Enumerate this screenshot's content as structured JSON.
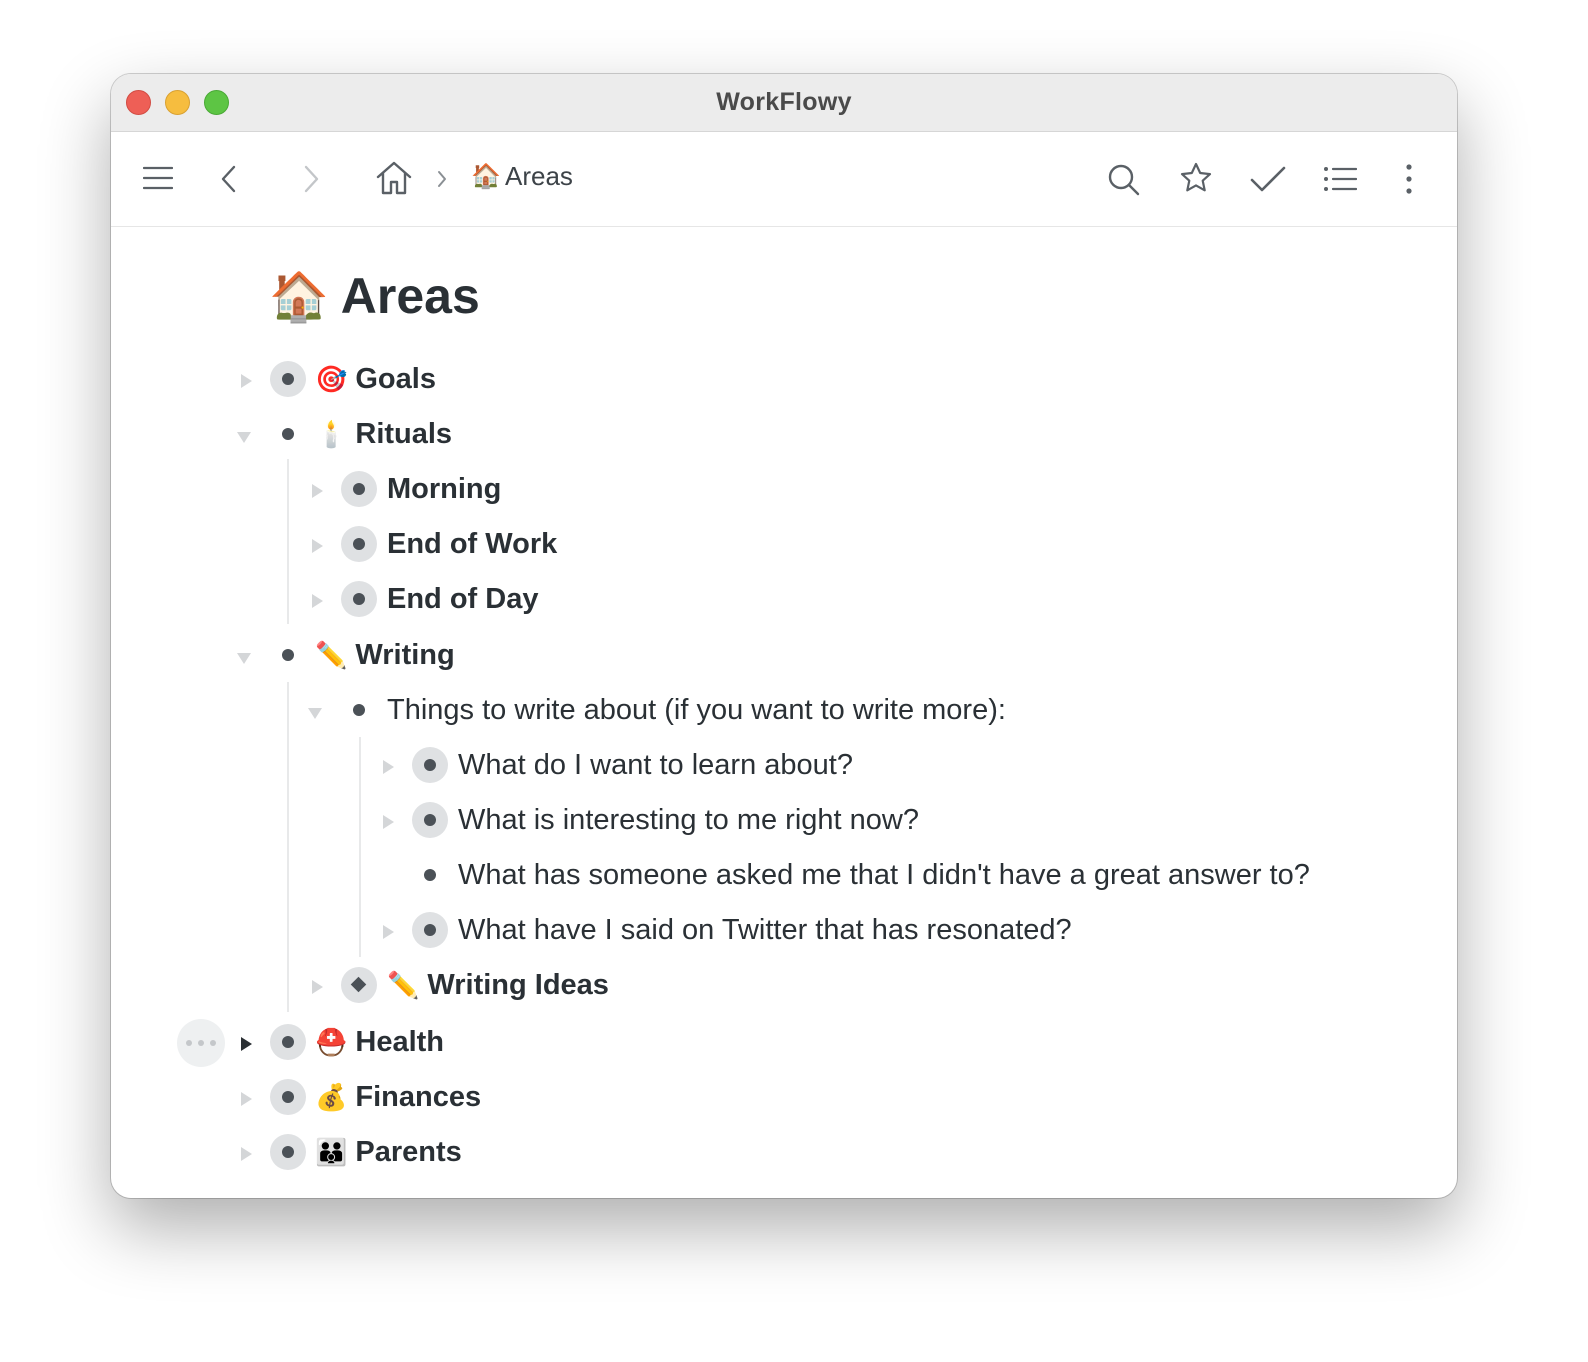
{
  "window": {
    "title": "WorkFlowy"
  },
  "breadcrumb": {
    "current": "Areas",
    "current_icon": "🏠"
  },
  "page": {
    "title": "Areas",
    "title_icon": "🏠"
  },
  "items": [
    {
      "id": "goals",
      "text": "Goals",
      "icon": "🎯",
      "bold": true
    },
    {
      "id": "rituals",
      "text": "Rituals",
      "icon": "🕯️",
      "bold": true
    },
    {
      "id": "morning",
      "text": "Morning",
      "icon": "",
      "bold": true
    },
    {
      "id": "end-of-work",
      "text": "End of Work",
      "icon": "",
      "bold": true
    },
    {
      "id": "end-of-day",
      "text": "End of Day",
      "icon": "",
      "bold": true
    },
    {
      "id": "writing",
      "text": "Writing",
      "icon": "✏️",
      "bold": true
    },
    {
      "id": "things-to-write",
      "text": "Things to write about (if you want to write more):",
      "icon": "",
      "bold": false
    },
    {
      "id": "learn-about",
      "text": "What do I want to learn about?",
      "icon": "",
      "bold": false
    },
    {
      "id": "interesting-now",
      "text": "What is interesting to me right now?",
      "icon": "",
      "bold": false
    },
    {
      "id": "someone-asked",
      "text": "What has someone asked me that I didn't have a great answer to?",
      "icon": "",
      "bold": false
    },
    {
      "id": "twitter-resonated",
      "text": "What have I said on Twitter that has resonated?",
      "icon": "",
      "bold": false
    },
    {
      "id": "writing-ideas",
      "text": "Writing Ideas",
      "icon": "✏️",
      "bold": true
    },
    {
      "id": "health",
      "text": "Health",
      "icon": "⛑️",
      "bold": true
    },
    {
      "id": "finances",
      "text": "Finances",
      "icon": "💰",
      "bold": true
    },
    {
      "id": "parents",
      "text": "Parents",
      "icon": "👪",
      "bold": true
    }
  ]
}
